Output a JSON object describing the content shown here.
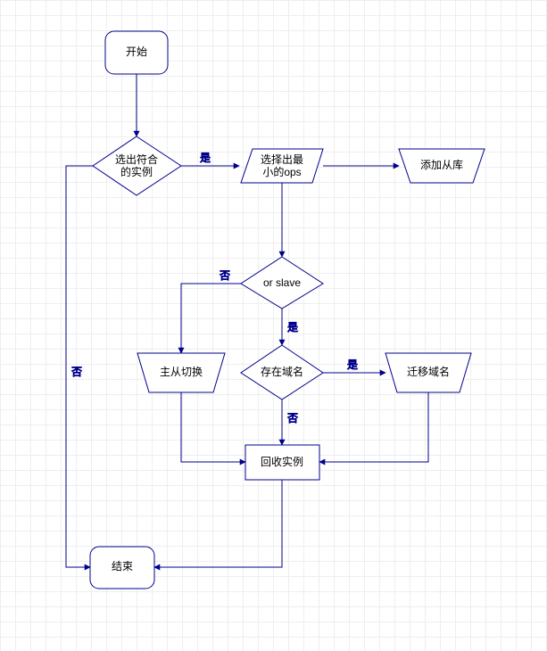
{
  "nodes": {
    "start": {
      "label": "开始"
    },
    "filter": {
      "line1": "选出符合",
      "line2": "的实例"
    },
    "select_ops": {
      "line1": "选择出最",
      "line2": "小的ops"
    },
    "add_slave": {
      "label": "添加从库"
    },
    "or_slave": {
      "label": "or slave"
    },
    "switch": {
      "label": "主从切换"
    },
    "has_domain": {
      "label": "存在域名"
    },
    "migrate": {
      "label": "迁移域名"
    },
    "recycle": {
      "label": "回收实例"
    },
    "end": {
      "label": "结束"
    }
  },
  "edges": {
    "filter_yes": "是",
    "filter_no": "否",
    "orslave_yes": "是",
    "orslave_no": "否",
    "domain_yes": "是",
    "domain_no": "否"
  }
}
